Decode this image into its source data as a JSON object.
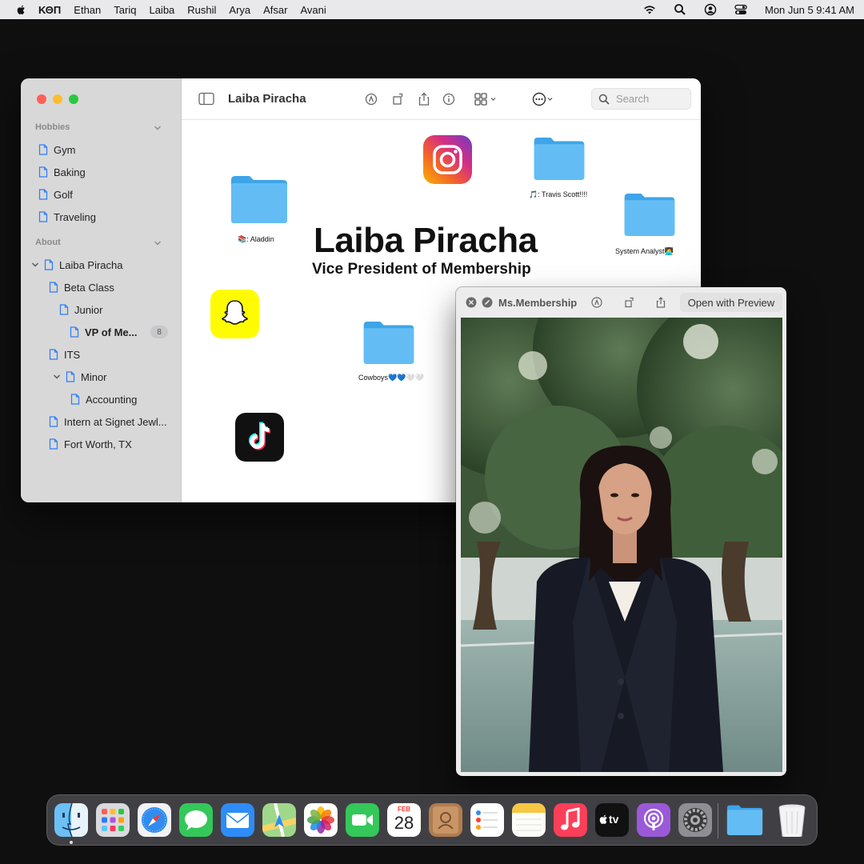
{
  "menubar": {
    "apple_icon": "apple-logo-icon",
    "items": [
      "ΚΘΠ",
      "Ethan",
      "Tariq",
      "Laiba",
      "Rushil",
      "Arya",
      "Afsar",
      "Avani"
    ],
    "status_icons": [
      "wifi-icon",
      "search-icon",
      "user-icon",
      "control-center-icon"
    ],
    "clock": "Mon Jun 5  9:41 AM"
  },
  "finder": {
    "title": "Laiba Piracha",
    "search_placeholder": "Search",
    "sidebar": {
      "sections": [
        {
          "label": "Hobbies",
          "items": [
            "Gym",
            "Baking",
            "Golf",
            "Traveling"
          ]
        },
        {
          "label": "About"
        }
      ],
      "tree": [
        {
          "label": "Laiba Piracha",
          "level": 0,
          "expanded": true
        },
        {
          "label": "Beta Class",
          "level": 1
        },
        {
          "label": "Junior",
          "level": 2
        },
        {
          "label": "VP of Me...",
          "level": 3,
          "selected": true,
          "badge": "8"
        },
        {
          "label": "ITS",
          "level": 1
        },
        {
          "label": "Minor",
          "level": 1,
          "expanded": true
        },
        {
          "label": "Accounting",
          "level": 2
        },
        {
          "label": "Intern at Signet Jewl...",
          "level": 1
        },
        {
          "label": "Fort Worth, TX",
          "level": 1
        }
      ]
    },
    "canvas": {
      "name": "Laiba Piracha",
      "role": "Vice President of Membership",
      "folders": [
        {
          "label": "📚: Aladdin"
        },
        {
          "label": "🎵: Travis Scott!!!!"
        },
        {
          "label": "System Analyst👩‍💻"
        },
        {
          "label": "Cowboys💙💙🤍🤍"
        }
      ],
      "apps": [
        "instagram-icon",
        "snapchat-icon",
        "tiktok-icon"
      ]
    }
  },
  "quicklook": {
    "title": "Ms.Membership",
    "open_button": "Open with Preview"
  },
  "dock": {
    "apps": [
      "Finder",
      "Launchpad",
      "Safari",
      "Messages",
      "Mail",
      "Maps",
      "Photos",
      "FaceTime",
      "Calendar",
      "Contacts",
      "Reminders",
      "Notes",
      "Music",
      "TV",
      "Podcasts",
      "System Settings",
      "Folder",
      "Trash"
    ],
    "calendar_month": "FEB",
    "calendar_day": "28",
    "tv_label": "tv"
  },
  "colors": {
    "accent": "#2e7cf6",
    "folder": "#5bb8f0",
    "snapchat": "#fffc00"
  }
}
